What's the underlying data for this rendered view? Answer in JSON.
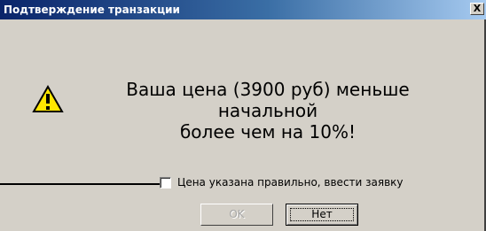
{
  "window": {
    "title": "Подтверждение транзакции",
    "close_glyph": "X"
  },
  "message": {
    "icon": "warning-icon",
    "text": "Ваша цена (3900 руб) меньше начальной\nболее чем на 10%!"
  },
  "confirmation": {
    "checkbox_label": "Цена указана правильно, ввести заявку",
    "checked": false
  },
  "buttons": {
    "ok_label": "OK",
    "cancel_label": "Нет"
  },
  "colors": {
    "window_background": "#d4d0c8",
    "titlebar_start": "#0a246a",
    "titlebar_end": "#a6caf0",
    "disabled_text": "#a6a6a6",
    "warning_yellow": "#ffe600"
  }
}
